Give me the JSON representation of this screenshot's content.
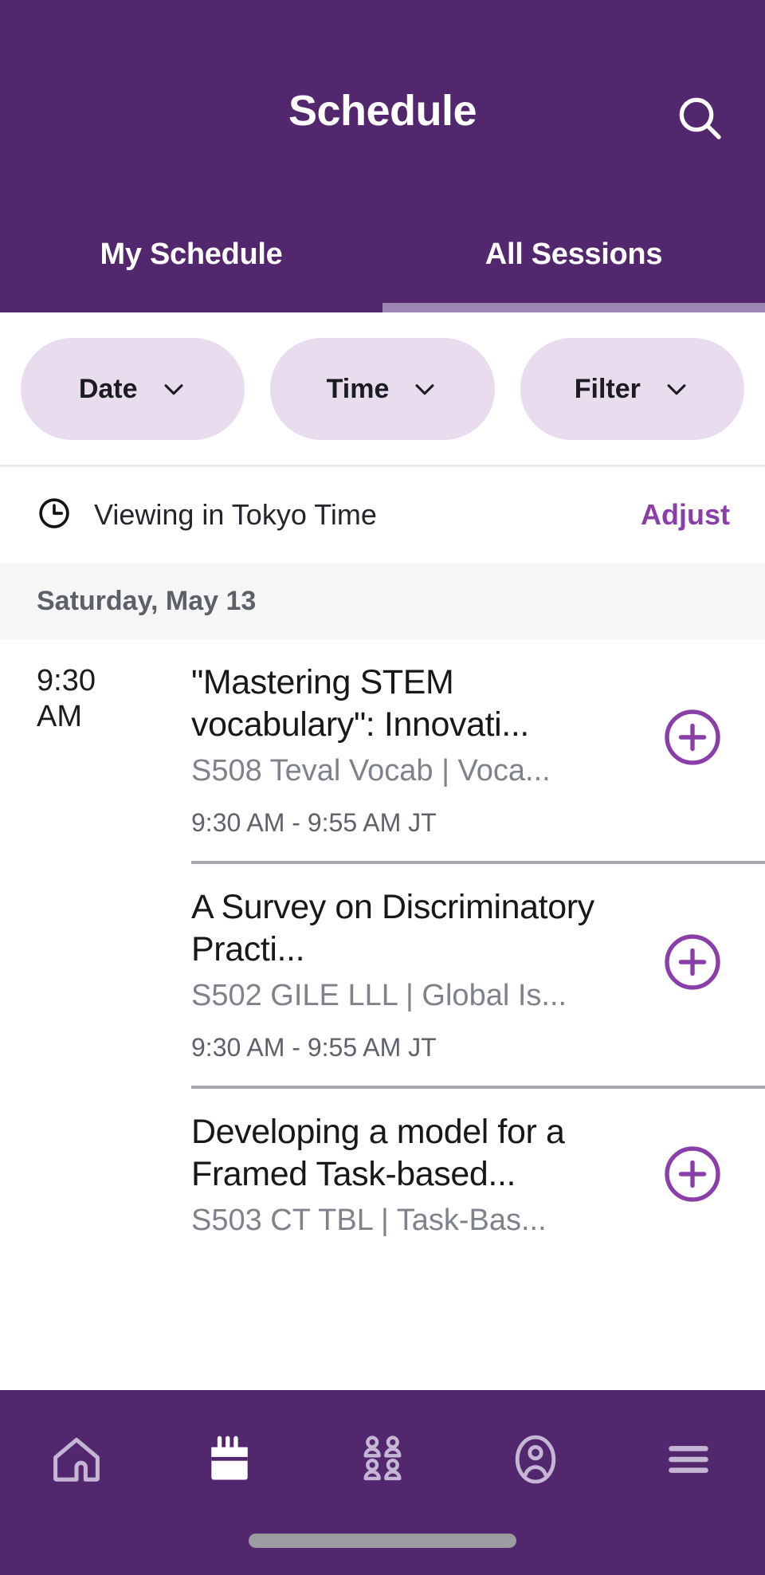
{
  "theme": {
    "brand_purple": "#52276D",
    "accent_purple": "#8A3FA8",
    "chip_bg": "#E8DCEE",
    "tab_indicator": "#9B86B4",
    "day_header_bg": "#F6F6F7",
    "divider": "#A7A8AE"
  },
  "header": {
    "title": "Schedule",
    "search_icon": "search-icon"
  },
  "tabs": [
    {
      "label": "My Schedule",
      "active": false
    },
    {
      "label": "All Sessions",
      "active": true
    }
  ],
  "filters": [
    {
      "label": "Date",
      "icon": "chevron-down-icon"
    },
    {
      "label": "Time",
      "icon": "chevron-down-icon"
    },
    {
      "label": "Filter",
      "icon": "chevron-down-icon"
    }
  ],
  "timezone_bar": {
    "icon": "clock-icon",
    "text": "Viewing in Tokyo Time",
    "adjust_label": "Adjust"
  },
  "day_header": {
    "label": "Saturday, May 13"
  },
  "sessions": [
    {
      "time_line1": "9:30",
      "time_line2": "AM",
      "title": "\"Mastering STEM vocabulary\": Innovati...",
      "subtitle": "S508 Teval Vocab | Voca...",
      "time_range": "9:30 AM - 9:55 AM JT",
      "action_icon": "plus-circle-icon"
    },
    {
      "time_line1": "",
      "time_line2": "",
      "title": "A Survey on Discriminatory Practi...",
      "subtitle": "S502 GILE LLL | Global Is...",
      "time_range": "9:30 AM - 9:55 AM JT",
      "action_icon": "plus-circle-icon"
    },
    {
      "time_line1": "",
      "time_line2": "",
      "title": "Developing a model for a Framed Task-based...",
      "subtitle": "S503 CT TBL | Task-Bas...",
      "time_range": "",
      "action_icon": "plus-circle-icon"
    }
  ],
  "bottom_nav": [
    {
      "name": "home-icon",
      "active": false
    },
    {
      "name": "calendar-icon",
      "active": true
    },
    {
      "name": "attendees-icon",
      "active": false
    },
    {
      "name": "profile-icon",
      "active": false
    },
    {
      "name": "menu-icon",
      "active": false
    }
  ]
}
